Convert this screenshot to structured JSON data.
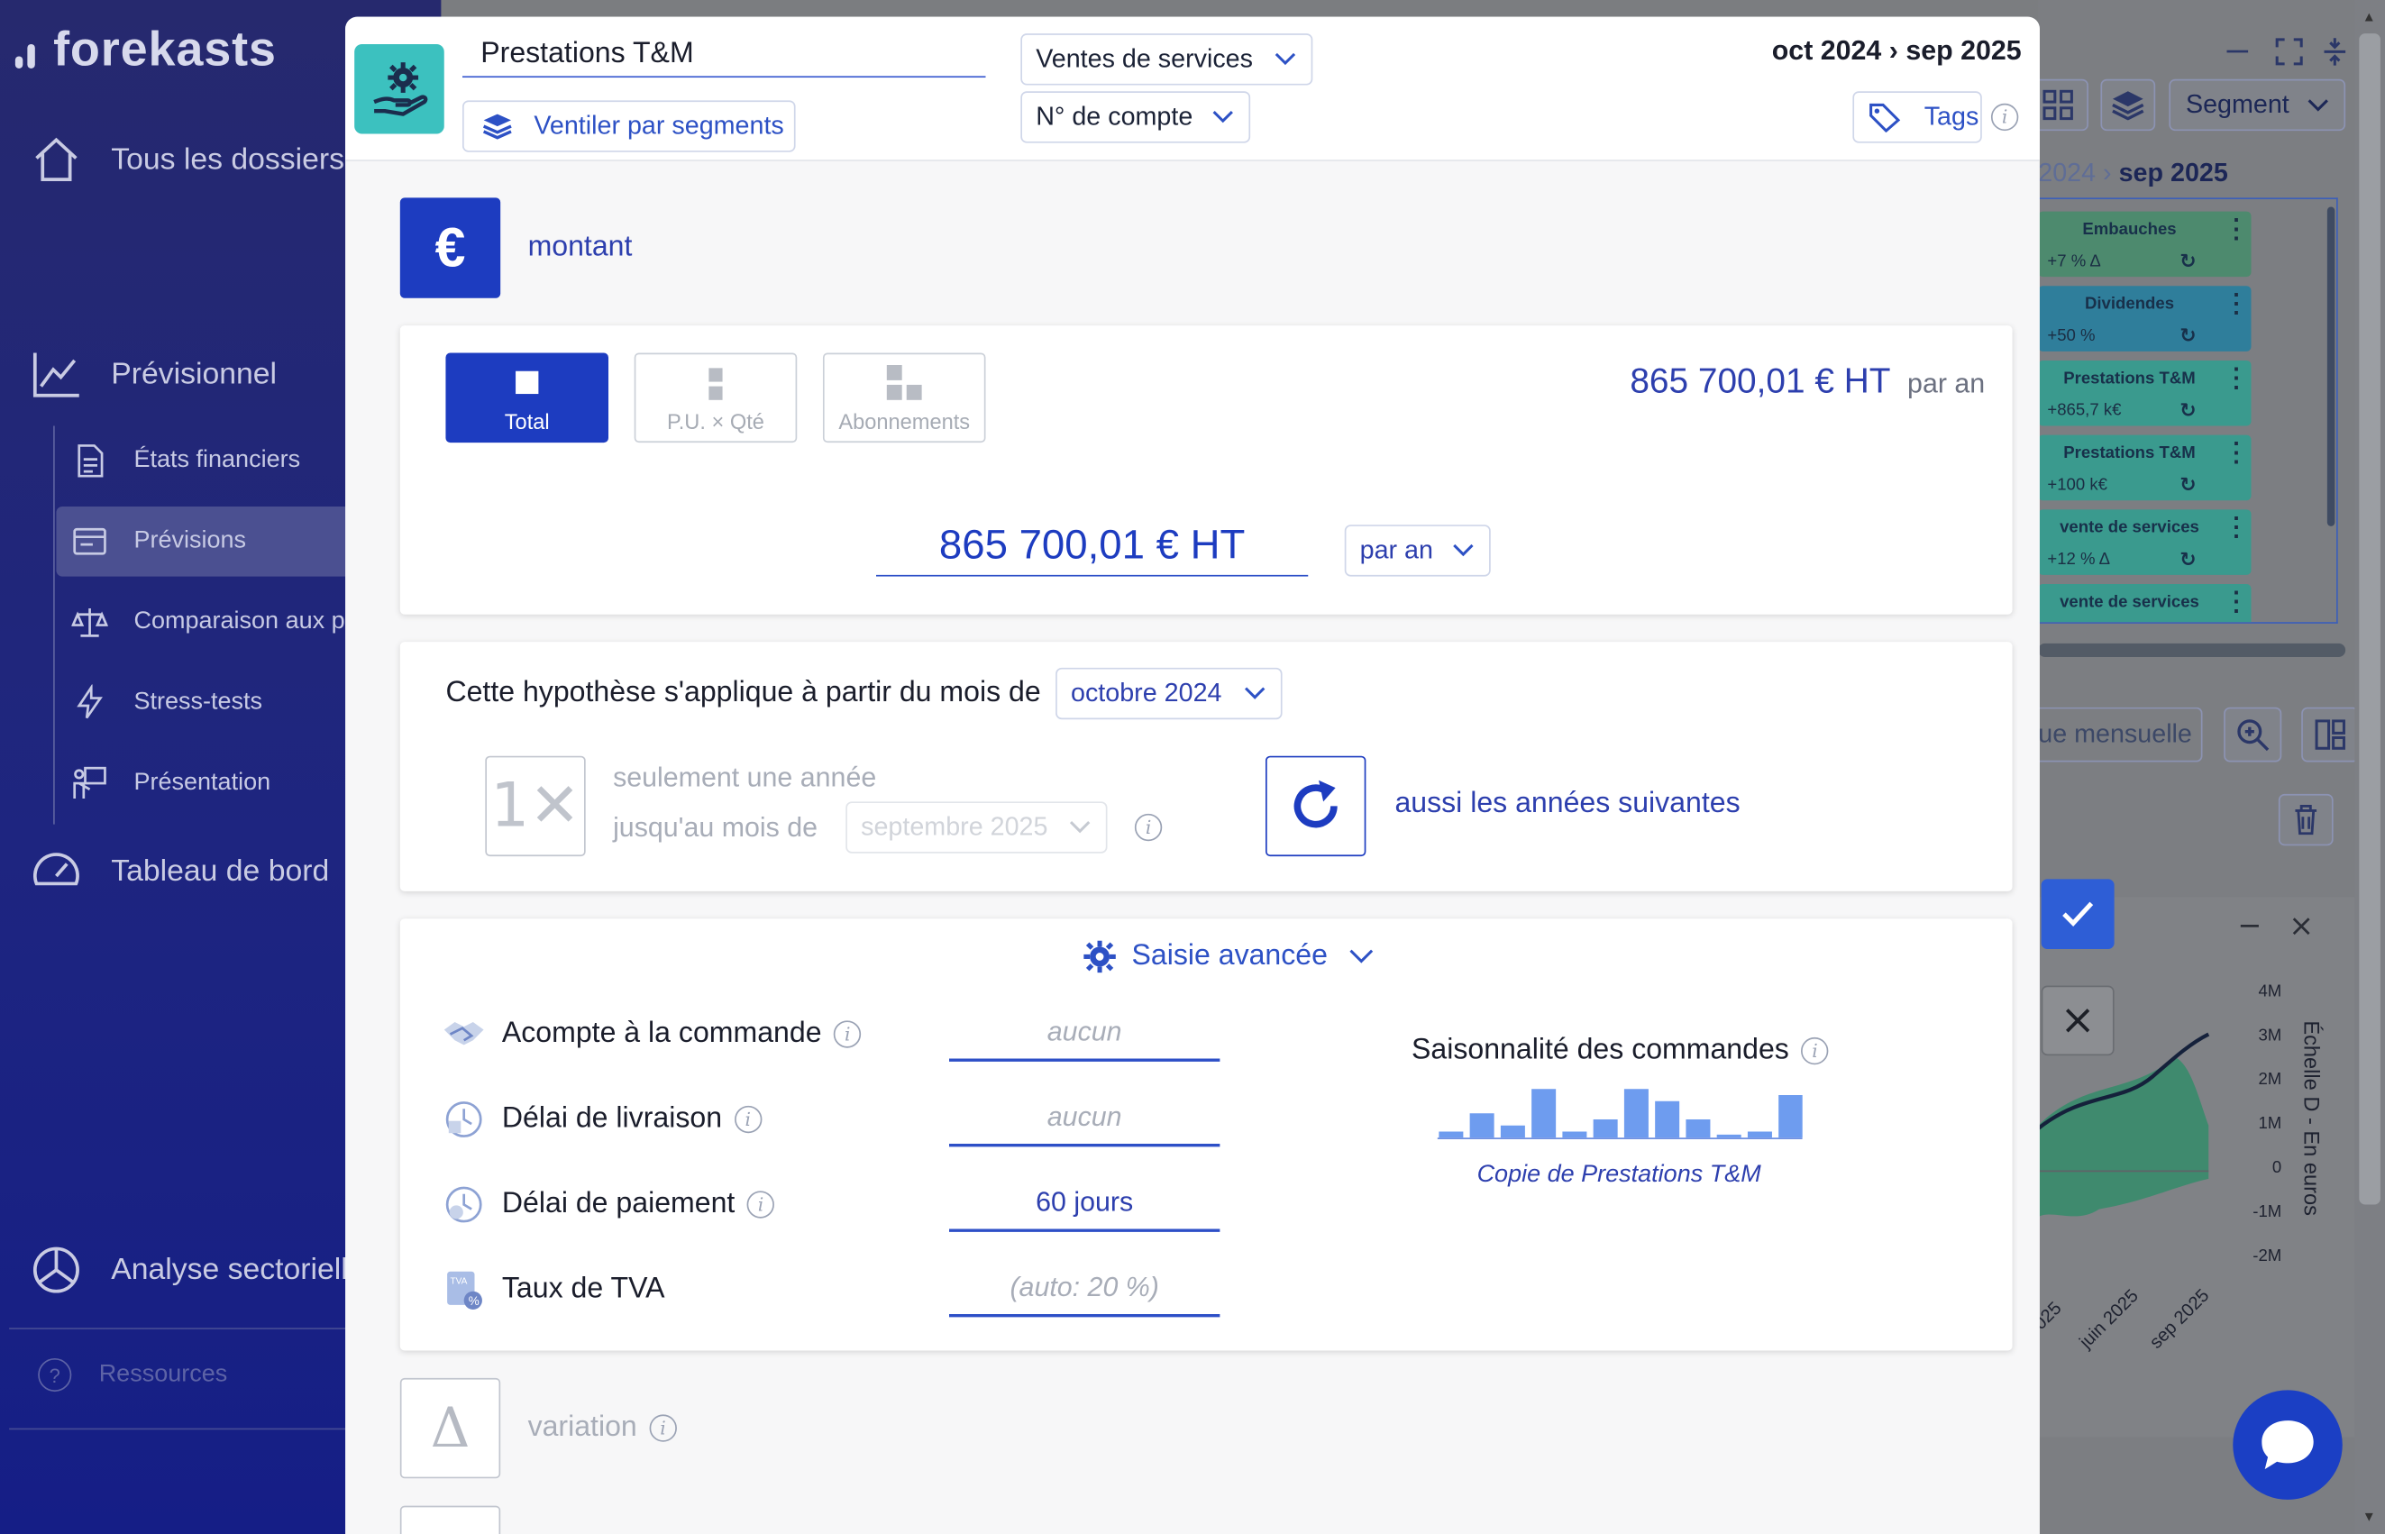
{
  "sidebar": {
    "brand": "forekasts",
    "items": {
      "dossiers": "Tous les dossiers",
      "previsionnel": "Prévisionnel",
      "etats": "États financiers",
      "previsions": "Prévisions",
      "comparaison": "Comparaison aux p",
      "stress": "Stress-tests",
      "presentation": "Présentation",
      "tableau": "Tableau de bord",
      "analyse": "Analyse sectorielle",
      "ressources": "Ressources"
    }
  },
  "modal": {
    "title": "Prestations T&M",
    "ventiler_label": "Ventiler par segments",
    "category_select": "Ventes de services",
    "account_select": "N° de compte",
    "period": "oct 2024 › sep 2025",
    "tags_label": "Tags",
    "amount_label": "montant",
    "modes": [
      "Total",
      "P.U. × Qté",
      "Abonnements"
    ],
    "total_display": "865 700,01 € HT",
    "per_year_suffix": "par an",
    "amount_input": "865 700,01 € HT",
    "frequency_select": "par an",
    "hypothesis_text": "Cette hypothèse s'applique à partir du mois de",
    "start_month": "octobre 2024",
    "once_line1": "seulement une année",
    "once_line2": "jusqu'au mois de",
    "end_month": "septembre 2025",
    "recurring_label": "aussi les années suivantes",
    "advanced_label": "Saisie avancée",
    "rows": [
      {
        "label": "Acompte à la commande",
        "value": "aucun"
      },
      {
        "label": "Délai de livraison",
        "value": "aucun"
      },
      {
        "label": "Délai de paiement",
        "value": "60 jours"
      },
      {
        "label": "Taux de TVA",
        "value": "(auto: 20 %)"
      }
    ],
    "seasonality_title": "Saisonnalité des commandes",
    "seasonality_caption": "Copie de Prestations T&M",
    "seasonality_bars": [
      1,
      4,
      2,
      8,
      1,
      3,
      8,
      6,
      3,
      0,
      1,
      7
    ],
    "variation_label": "variation"
  },
  "background": {
    "segment_label": "Segment",
    "period_prefix": "2024 ›",
    "period_suffix": "sep 2025",
    "cards": [
      {
        "title": "Embauches",
        "value": "+7 % Δ",
        "color": "#4d8a6e"
      },
      {
        "title": "Dividendes",
        "value": "+50 %",
        "color": "#2f7e9b"
      },
      {
        "title": "Prestations T&M",
        "value": "+865,7 k€",
        "color": "#3a9a8e"
      },
      {
        "title": "Prestations T&M",
        "value": "+100 k€",
        "color": "#3a9a8e"
      },
      {
        "title": "vente de services",
        "value": "+12 % Δ",
        "color": "#3a9a8e"
      },
      {
        "title": "vente de services",
        "value": "",
        "color": "#3a9a8e"
      }
    ],
    "mensuelle_label": "ue mensuelle",
    "chart_axis_label": "Échelle D - En euros",
    "chart_ticks": [
      "4M",
      "3M",
      "2M",
      "1M",
      "0",
      "-1M",
      "-2M"
    ],
    "chart_x_ticks": [
      "025",
      "juin 2025",
      "sep 2025"
    ]
  }
}
